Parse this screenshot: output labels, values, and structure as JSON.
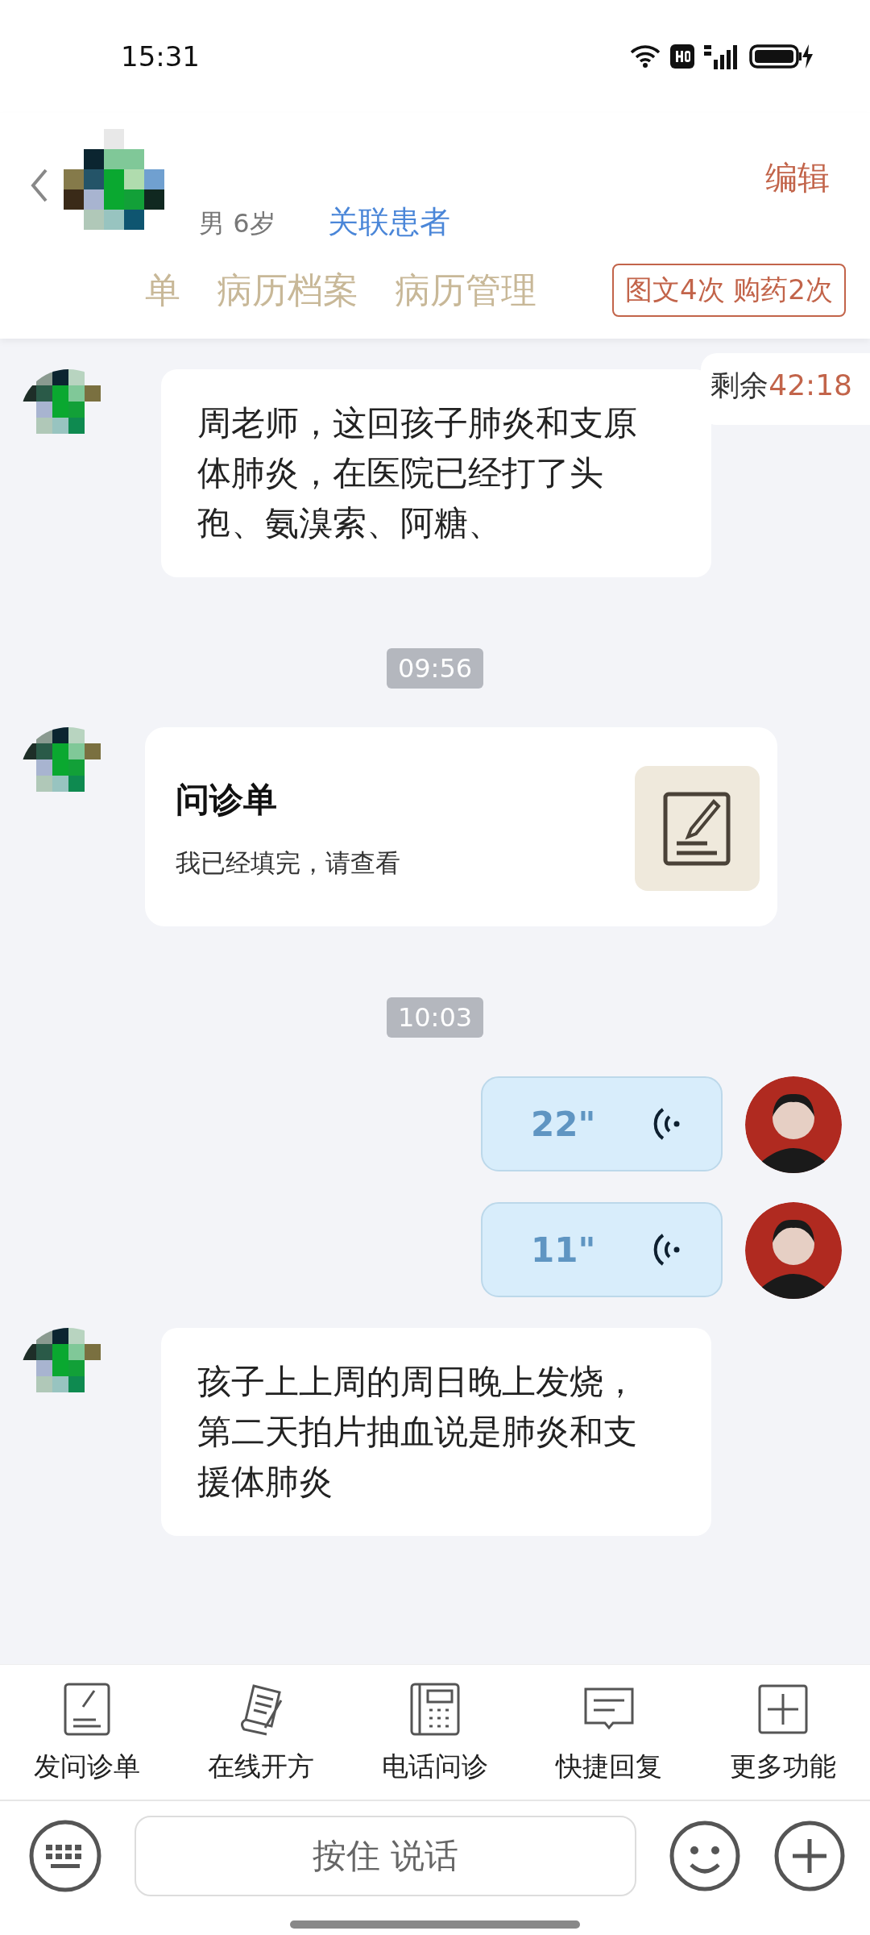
{
  "status_bar": {
    "time": "15:31"
  },
  "header": {
    "gender_age": "男 6岁",
    "link": "关联患者",
    "edit": "编辑"
  },
  "tabs": [
    {
      "label": "单"
    },
    {
      "label": "病历档案"
    },
    {
      "label": "病历管理"
    }
  ],
  "quota": "图文4次 购药2次",
  "timer": {
    "label": "剩余",
    "value": "42:18"
  },
  "messages": [
    {
      "kind": "text",
      "text": "周老师，这回孩子肺炎和支原体肺炎，在医院已经打了头孢、氨溴索、阿糖、"
    },
    {
      "kind": "time",
      "text": "09:56"
    },
    {
      "kind": "form",
      "title": "问诊单",
      "subtitle": "我已经填完，请查看"
    },
    {
      "kind": "time",
      "text": "10:03"
    },
    {
      "kind": "voice",
      "duration": "22\""
    },
    {
      "kind": "voice",
      "duration": "11\""
    },
    {
      "kind": "text",
      "text": "孩子上上周的周日晚上发烧，第二天拍片抽血说是肺炎和支援体肺炎"
    }
  ],
  "tools": [
    {
      "kind": "form",
      "label": "发问诊单"
    },
    {
      "kind": "prescription",
      "label": "在线开方"
    },
    {
      "kind": "phone",
      "label": "电话问诊"
    },
    {
      "kind": "reply",
      "label": "快捷回复"
    },
    {
      "kind": "more",
      "label": "更多功能"
    }
  ],
  "input": {
    "hold_to_talk": "按住 说话"
  }
}
